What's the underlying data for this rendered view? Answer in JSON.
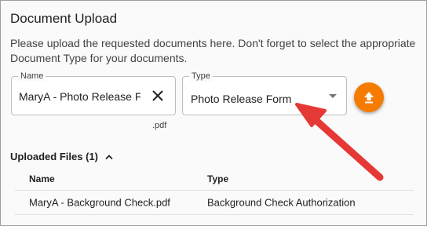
{
  "panel": {
    "title": "Document Upload",
    "description": "Please upload the requested documents here. Don't forget to select the appropriate Document Type for your documents."
  },
  "name_field": {
    "label": "Name",
    "value": "MaryA - Photo Release Fo",
    "extension": ".pdf"
  },
  "type_field": {
    "label": "Type",
    "value": "Photo Release Form"
  },
  "uploaded": {
    "header": "Uploaded Files (1)",
    "columns": [
      "Name",
      "Type"
    ],
    "rows": [
      {
        "name": "MaryA - Background Check.pdf",
        "type": "Background Check Authorization"
      }
    ]
  },
  "icons": {
    "clear": "close-icon",
    "dropdown": "dropdown-caret-icon",
    "upload": "upload-icon",
    "collapse": "chevron-up-icon"
  },
  "colors": {
    "accent": "#f57c00",
    "annotation": "#e53935"
  }
}
